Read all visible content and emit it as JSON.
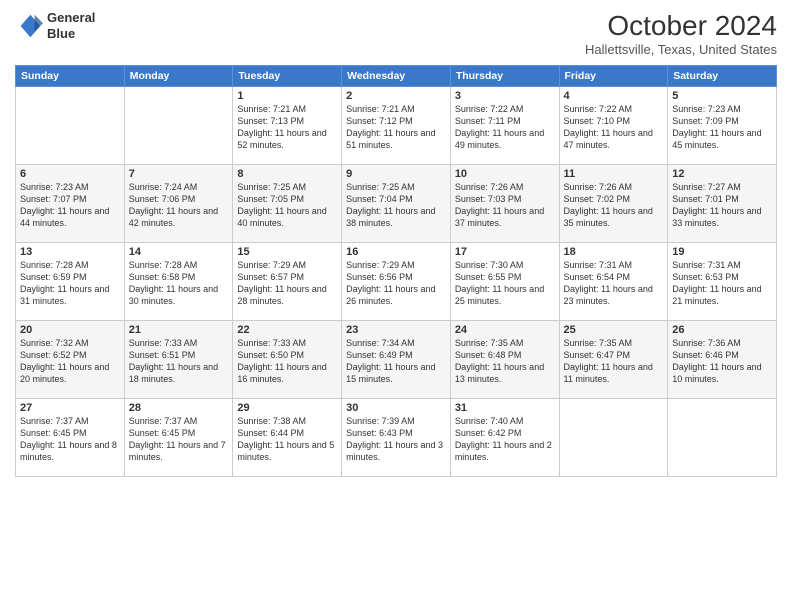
{
  "header": {
    "logo_line1": "General",
    "logo_line2": "Blue",
    "month": "October 2024",
    "location": "Hallettsville, Texas, United States"
  },
  "days_of_week": [
    "Sunday",
    "Monday",
    "Tuesday",
    "Wednesday",
    "Thursday",
    "Friday",
    "Saturday"
  ],
  "weeks": [
    [
      {
        "day": "",
        "info": ""
      },
      {
        "day": "",
        "info": ""
      },
      {
        "day": "1",
        "info": "Sunrise: 7:21 AM\nSunset: 7:13 PM\nDaylight: 11 hours and 52 minutes."
      },
      {
        "day": "2",
        "info": "Sunrise: 7:21 AM\nSunset: 7:12 PM\nDaylight: 11 hours and 51 minutes."
      },
      {
        "day": "3",
        "info": "Sunrise: 7:22 AM\nSunset: 7:11 PM\nDaylight: 11 hours and 49 minutes."
      },
      {
        "day": "4",
        "info": "Sunrise: 7:22 AM\nSunset: 7:10 PM\nDaylight: 11 hours and 47 minutes."
      },
      {
        "day": "5",
        "info": "Sunrise: 7:23 AM\nSunset: 7:09 PM\nDaylight: 11 hours and 45 minutes."
      }
    ],
    [
      {
        "day": "6",
        "info": "Sunrise: 7:23 AM\nSunset: 7:07 PM\nDaylight: 11 hours and 44 minutes."
      },
      {
        "day": "7",
        "info": "Sunrise: 7:24 AM\nSunset: 7:06 PM\nDaylight: 11 hours and 42 minutes."
      },
      {
        "day": "8",
        "info": "Sunrise: 7:25 AM\nSunset: 7:05 PM\nDaylight: 11 hours and 40 minutes."
      },
      {
        "day": "9",
        "info": "Sunrise: 7:25 AM\nSunset: 7:04 PM\nDaylight: 11 hours and 38 minutes."
      },
      {
        "day": "10",
        "info": "Sunrise: 7:26 AM\nSunset: 7:03 PM\nDaylight: 11 hours and 37 minutes."
      },
      {
        "day": "11",
        "info": "Sunrise: 7:26 AM\nSunset: 7:02 PM\nDaylight: 11 hours and 35 minutes."
      },
      {
        "day": "12",
        "info": "Sunrise: 7:27 AM\nSunset: 7:01 PM\nDaylight: 11 hours and 33 minutes."
      }
    ],
    [
      {
        "day": "13",
        "info": "Sunrise: 7:28 AM\nSunset: 6:59 PM\nDaylight: 11 hours and 31 minutes."
      },
      {
        "day": "14",
        "info": "Sunrise: 7:28 AM\nSunset: 6:58 PM\nDaylight: 11 hours and 30 minutes."
      },
      {
        "day": "15",
        "info": "Sunrise: 7:29 AM\nSunset: 6:57 PM\nDaylight: 11 hours and 28 minutes."
      },
      {
        "day": "16",
        "info": "Sunrise: 7:29 AM\nSunset: 6:56 PM\nDaylight: 11 hours and 26 minutes."
      },
      {
        "day": "17",
        "info": "Sunrise: 7:30 AM\nSunset: 6:55 PM\nDaylight: 11 hours and 25 minutes."
      },
      {
        "day": "18",
        "info": "Sunrise: 7:31 AM\nSunset: 6:54 PM\nDaylight: 11 hours and 23 minutes."
      },
      {
        "day": "19",
        "info": "Sunrise: 7:31 AM\nSunset: 6:53 PM\nDaylight: 11 hours and 21 minutes."
      }
    ],
    [
      {
        "day": "20",
        "info": "Sunrise: 7:32 AM\nSunset: 6:52 PM\nDaylight: 11 hours and 20 minutes."
      },
      {
        "day": "21",
        "info": "Sunrise: 7:33 AM\nSunset: 6:51 PM\nDaylight: 11 hours and 18 minutes."
      },
      {
        "day": "22",
        "info": "Sunrise: 7:33 AM\nSunset: 6:50 PM\nDaylight: 11 hours and 16 minutes."
      },
      {
        "day": "23",
        "info": "Sunrise: 7:34 AM\nSunset: 6:49 PM\nDaylight: 11 hours and 15 minutes."
      },
      {
        "day": "24",
        "info": "Sunrise: 7:35 AM\nSunset: 6:48 PM\nDaylight: 11 hours and 13 minutes."
      },
      {
        "day": "25",
        "info": "Sunrise: 7:35 AM\nSunset: 6:47 PM\nDaylight: 11 hours and 11 minutes."
      },
      {
        "day": "26",
        "info": "Sunrise: 7:36 AM\nSunset: 6:46 PM\nDaylight: 11 hours and 10 minutes."
      }
    ],
    [
      {
        "day": "27",
        "info": "Sunrise: 7:37 AM\nSunset: 6:45 PM\nDaylight: 11 hours and 8 minutes."
      },
      {
        "day": "28",
        "info": "Sunrise: 7:37 AM\nSunset: 6:45 PM\nDaylight: 11 hours and 7 minutes."
      },
      {
        "day": "29",
        "info": "Sunrise: 7:38 AM\nSunset: 6:44 PM\nDaylight: 11 hours and 5 minutes."
      },
      {
        "day": "30",
        "info": "Sunrise: 7:39 AM\nSunset: 6:43 PM\nDaylight: 11 hours and 3 minutes."
      },
      {
        "day": "31",
        "info": "Sunrise: 7:40 AM\nSunset: 6:42 PM\nDaylight: 11 hours and 2 minutes."
      },
      {
        "day": "",
        "info": ""
      },
      {
        "day": "",
        "info": ""
      }
    ]
  ]
}
